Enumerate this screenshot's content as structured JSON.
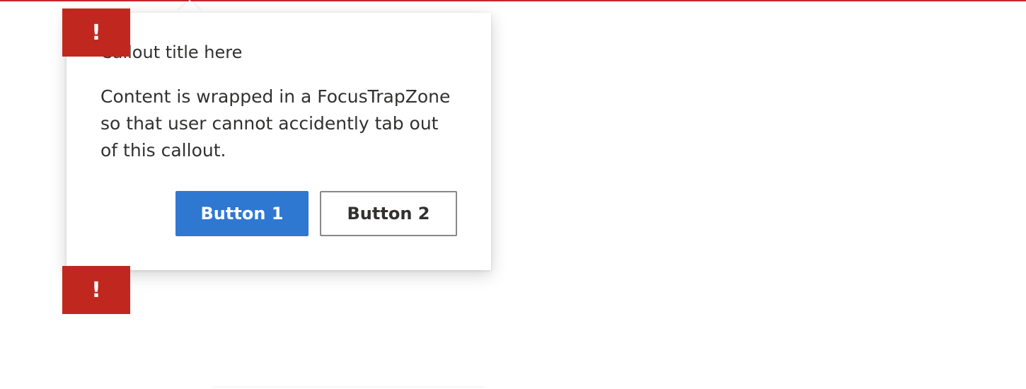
{
  "callout": {
    "title": "Callout title here",
    "body": "Content is wrapped in a FocusTrapZone so that user cannot accidently tab out of this callout.",
    "buttons": {
      "primary": "Button 1",
      "secondary": "Button 2"
    }
  },
  "badges": {
    "top": {
      "icon": "alert-icon",
      "glyph": "!"
    },
    "bottom": {
      "icon": "alert-icon",
      "glyph": "!"
    }
  },
  "colors": {
    "accent": "#2f78d2",
    "alert": "#c0281f",
    "rule": "#c4262e"
  }
}
